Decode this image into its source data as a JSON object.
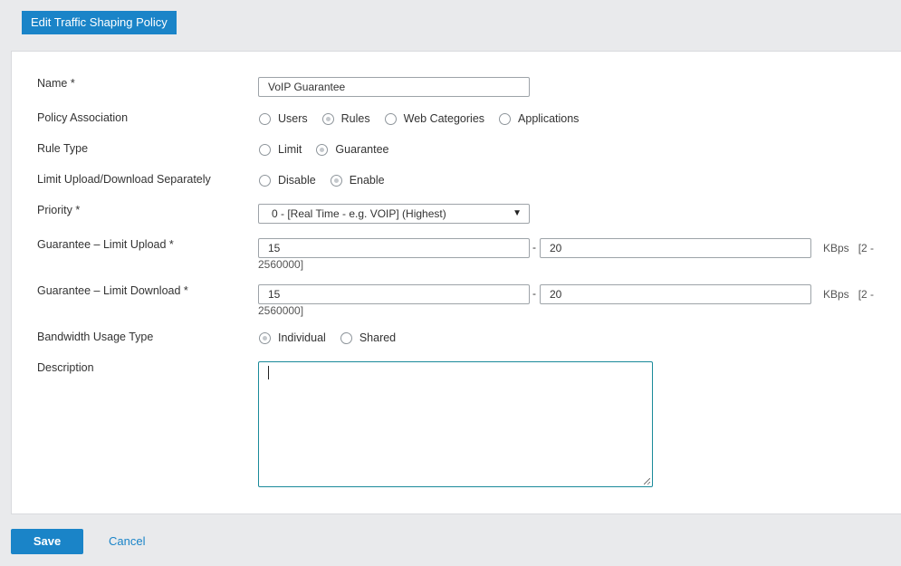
{
  "header": {
    "title": "Edit Traffic Shaping Policy"
  },
  "form": {
    "name": {
      "label": "Name *",
      "value": "VoIP Guarantee"
    },
    "policy_association": {
      "label": "Policy Association",
      "options": [
        "Users",
        "Rules",
        "Web Categories",
        "Applications"
      ],
      "selected": "Rules"
    },
    "rule_type": {
      "label": "Rule Type",
      "options": [
        "Limit",
        "Guarantee"
      ],
      "selected": "Guarantee"
    },
    "limit_separately": {
      "label": "Limit Upload/Download Separately",
      "options": [
        "Disable",
        "Enable"
      ],
      "selected": "Enable"
    },
    "priority": {
      "label": "Priority *",
      "value": "0 - [Real Time - e.g. VOIP] (Highest)"
    },
    "upload": {
      "label": "Guarantee – Limit Upload *",
      "min": "15",
      "max": "20",
      "separator": "-",
      "unit": "KBps",
      "range_a": "[2 -",
      "range_b": "2560000]"
    },
    "download": {
      "label": "Guarantee – Limit Download *",
      "min": "15",
      "max": "20",
      "separator": "-",
      "unit": "KBps",
      "range_a": "[2 -",
      "range_b": "2560000]"
    },
    "bandwidth_usage": {
      "label": "Bandwidth Usage Type",
      "options": [
        "Individual",
        "Shared"
      ],
      "selected": "Individual"
    },
    "description": {
      "label": "Description",
      "value": ""
    }
  },
  "actions": {
    "save": "Save",
    "cancel": "Cancel"
  },
  "colors": {
    "accent": "#1a84c8",
    "focus_border": "#1a8a9a"
  }
}
